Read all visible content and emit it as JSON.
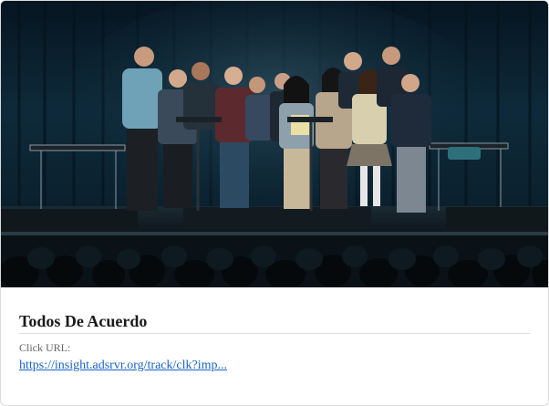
{
  "card": {
    "title": "Todos De Acuerdo",
    "click_url_label": "Click URL:",
    "click_url": "https://insight.adsrvr.org/track/clk?imp..."
  },
  "hero_image": {
    "subject": "photo-students-on-stage"
  },
  "colors": {
    "link": "#1a62c7",
    "title": "#1a1a1a",
    "stage_curtain": "#0e2a3a",
    "border": "#dcdcdc"
  }
}
